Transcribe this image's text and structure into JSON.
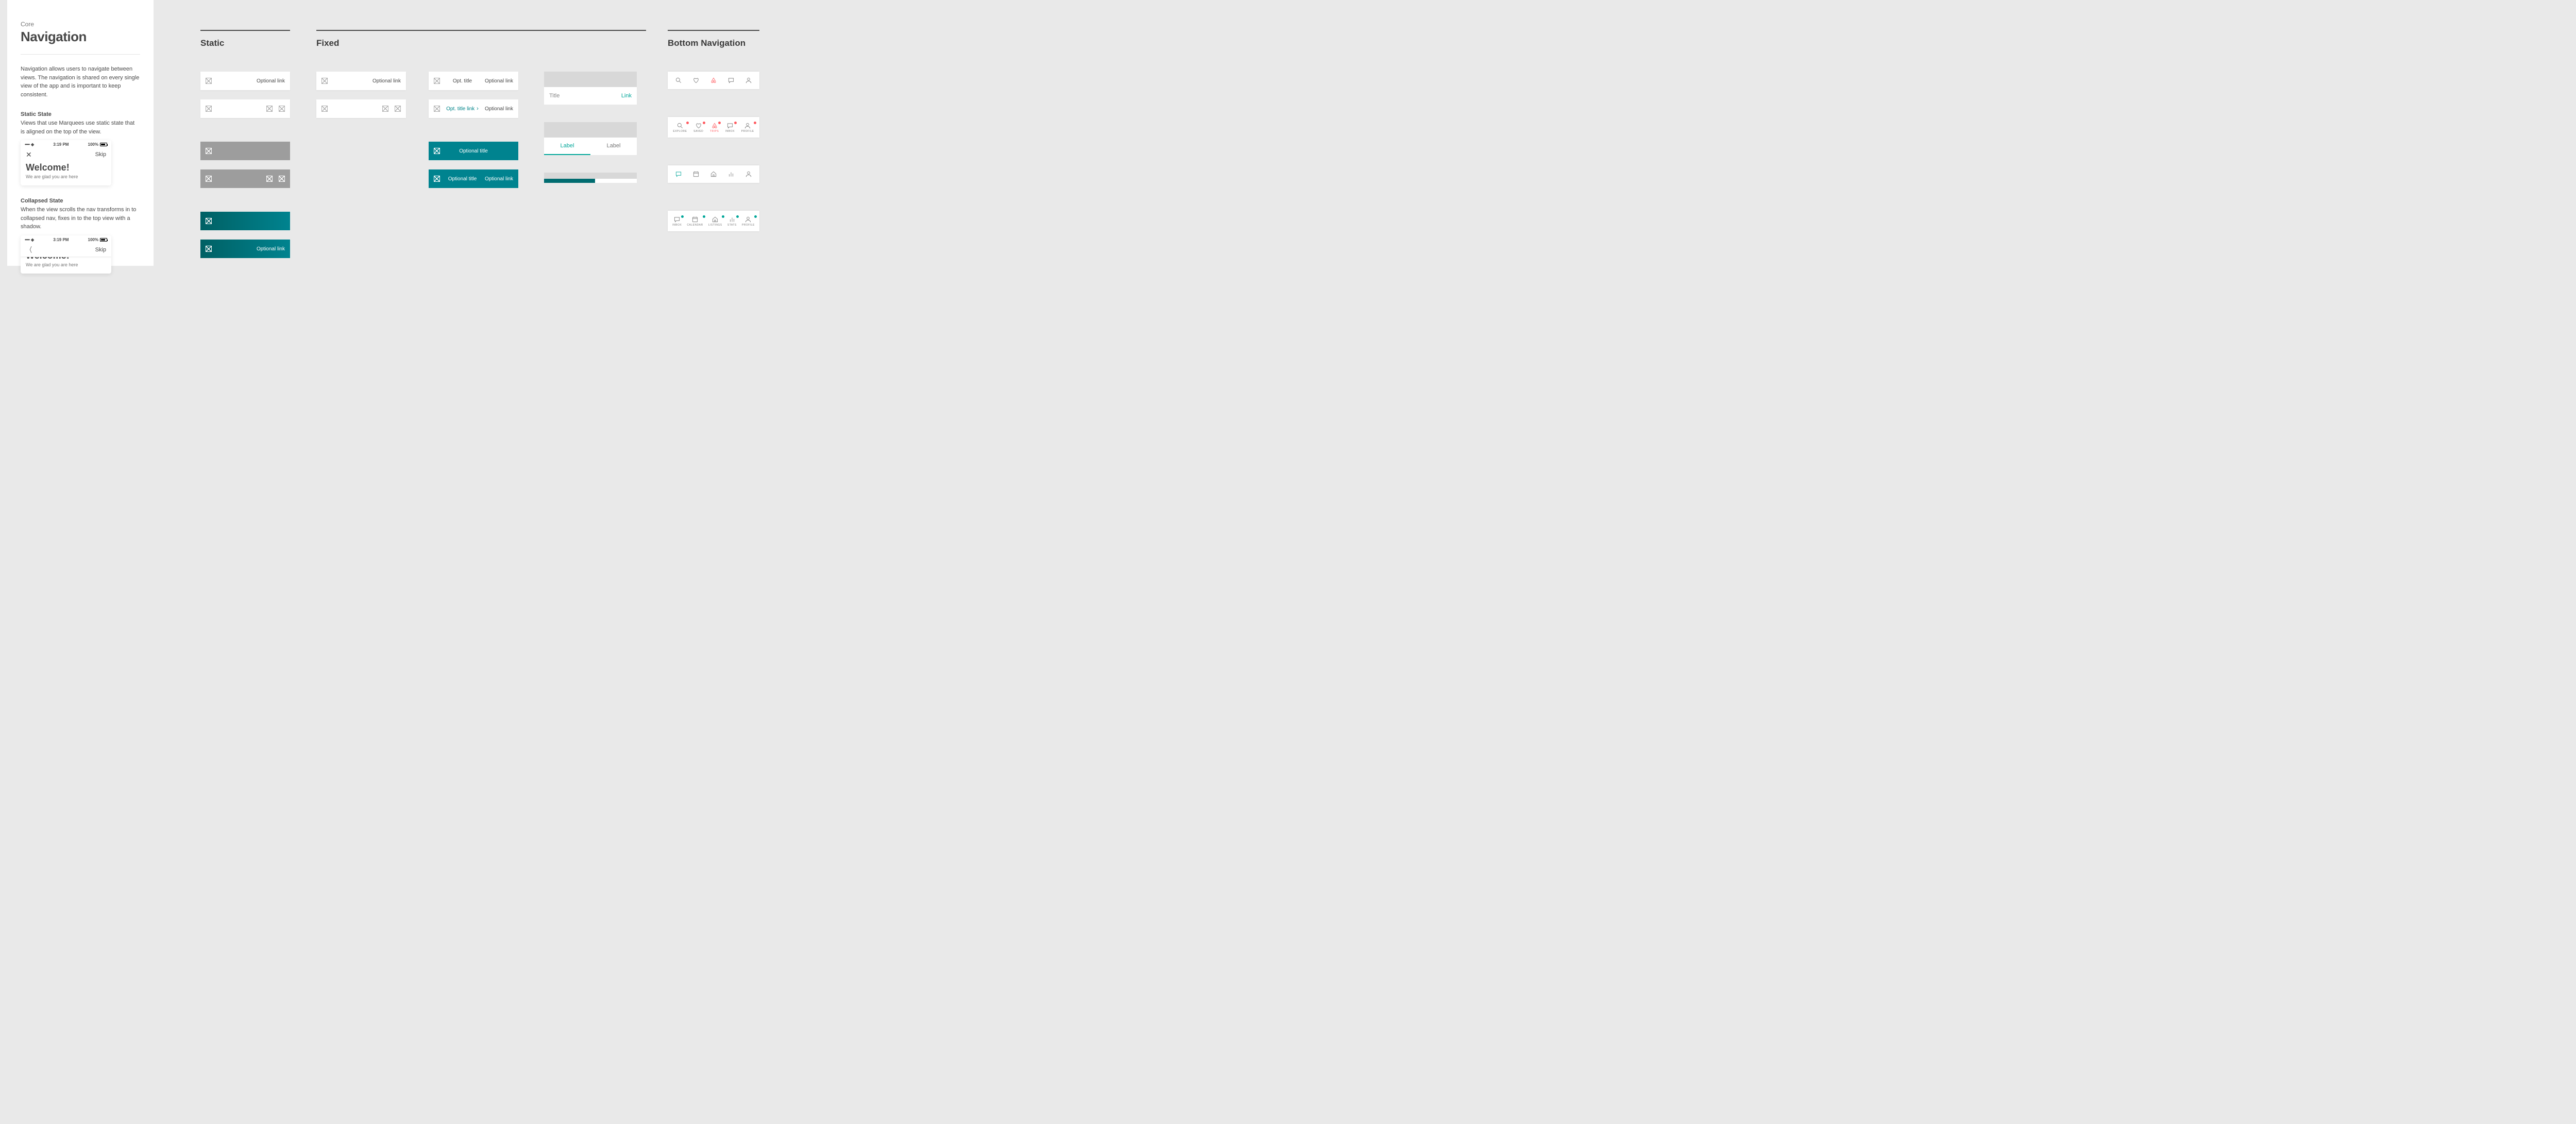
{
  "sidebar": {
    "eyebrow": "Core",
    "title": "Navigation",
    "intro": "Navigation allows users to navigate between views. The navigation is shared on every single view of the app and is important to keep consistent.",
    "static_h": "Static State",
    "static_p": "Views that use Marquees use static state that is aligned on the top of the view.",
    "collapsed_h": "Collapsed State",
    "collapsed_p": "When the view scrolls the nav transforms in to collapsed nav, fixes in to the top view with a shadow.",
    "phone": {
      "carrier": "•••••",
      "wifiAria": "wifi",
      "time": "3:19 PM",
      "batt": "100%",
      "skip": "Skip",
      "hero": "Welcome!",
      "sub": "We are glad you are here"
    }
  },
  "sections": {
    "static": "Static",
    "fixed": "Fixed",
    "bottom": "Bottom Navigation"
  },
  "nav": {
    "optional_link": "Optional link",
    "opt_title": "Opt. title",
    "opt_title_link": "Opt. title link",
    "optional_title": "Optional title"
  },
  "tabsec": {
    "title": "Title",
    "link": "Link",
    "label": "Label"
  },
  "bottomnav": {
    "guest": {
      "explore": "EXPLORE",
      "saved": "SAVED",
      "trips": "TRIPS",
      "inbox": "INBOX",
      "profile": "PROFILE"
    },
    "host": {
      "inbox": "INBOX",
      "calendar": "CALENDAR",
      "listings": "LISTINGS",
      "stats": "STATS",
      "profile": "PROFILE"
    }
  }
}
